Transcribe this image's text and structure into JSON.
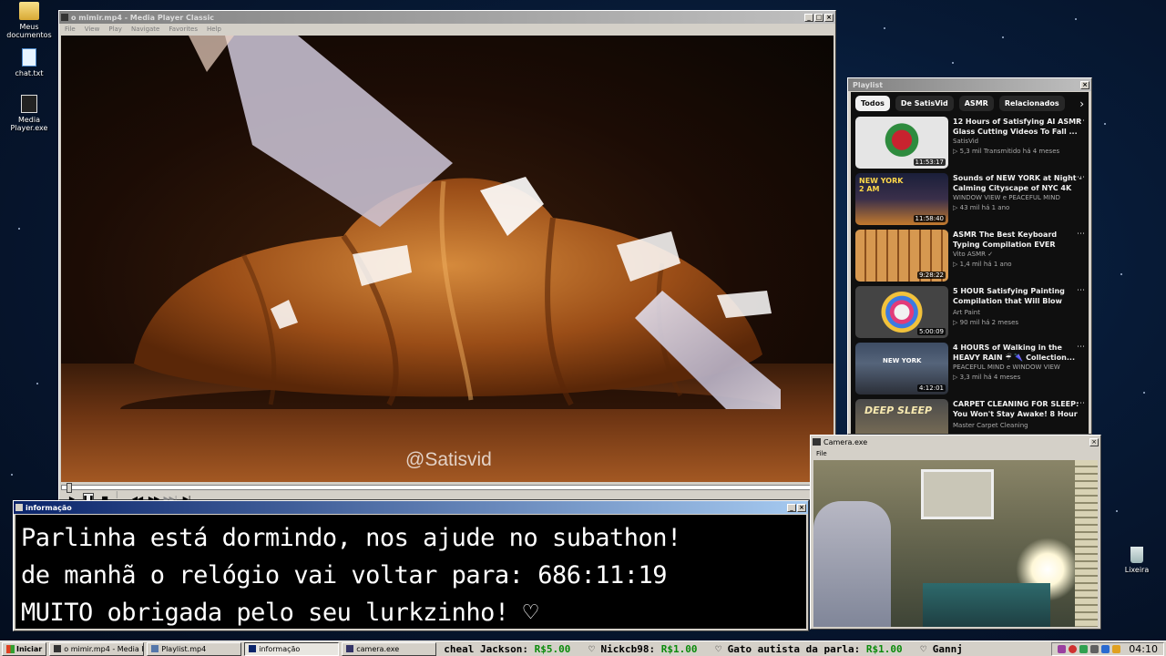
{
  "desktop": {
    "icons": [
      {
        "label": "Meus documentos",
        "icon": "folder-icon"
      },
      {
        "label": "chat.txt",
        "icon": "notepad-icon"
      },
      {
        "label": "Media Player.exe",
        "icon": "media-player-icon"
      },
      {
        "label": "Lixeira",
        "icon": "recycle-bin-icon"
      }
    ]
  },
  "media_player": {
    "title": "o mimir.mp4 - Media Player Classic",
    "menu": [
      "File",
      "View",
      "Play",
      "Navigate",
      "Favorites",
      "Help"
    ],
    "watermark": "@Satisvid",
    "progress": 0.0
  },
  "playlist": {
    "title": "Playlist",
    "chips": [
      "Todos",
      "De SatisVid",
      "ASMR",
      "Relacionados"
    ],
    "active_chip": "Todos",
    "videos": [
      {
        "title": "12 Hours of Satisfying AI ASMR Glass Cutting Videos To Fall ...",
        "channel": "SatisVid",
        "stats": "5,3 mil  Transmitido há 4 meses",
        "duration": "11:53:17",
        "thumb_text": ""
      },
      {
        "title": "Sounds of NEW YORK at Night - Calming Cityscape of NYC 4K",
        "channel": "WINDOW VIEW e PEACEFUL MIND",
        "stats": "43 mil  há 1 ano",
        "duration": "11:58:40",
        "thumb_text": "NEW YORK 2 AM"
      },
      {
        "title": "ASMR The Best Keyboard Typing Compilation EVER",
        "channel": "Vito ASMR ✓",
        "stats": "1,4 mil  há 1 ano",
        "duration": "9:28:22",
        "thumb_text": ""
      },
      {
        "title": "5 HOUR Satisfying Painting Compilation that Will Blow You...",
        "channel": "Art Paint",
        "stats": "90 mil  há 2 meses",
        "duration": "5:00:09",
        "thumb_text": ""
      },
      {
        "title": "4 HOURS of Walking in the HEAVY RAIN ☔ 🌂 Collection...",
        "channel": "PEACEFUL MIND e WINDOW VIEW",
        "stats": "3,3 mil  há 4 meses",
        "duration": "4:12:01",
        "thumb_text": "NEW YORK"
      },
      {
        "title": "CARPET CLEANING FOR SLEEP: You Won't Stay Awake! 8 Hour ...",
        "channel": "Master Carpet Cleaning",
        "stats": "",
        "duration": "",
        "thumb_text": "DEEP SLEEP"
      }
    ]
  },
  "info_window": {
    "title": "informação",
    "lines": [
      "Parlinha está dormindo, nos ajude no subathon!",
      "de manhã o relógio vai voltar para:  686:11:19",
      "MUITO obrigada pelo seu lurkzinho! ♡"
    ]
  },
  "camera_window": {
    "title": "Camera.exe",
    "menu": [
      "File"
    ]
  },
  "taskbar": {
    "start_label": "Iniciar",
    "tasks": [
      {
        "label": "o mimir.mp4 - Media Playe...",
        "pressed": false
      },
      {
        "label": "Playlist.mp4",
        "pressed": false
      },
      {
        "label": "informação",
        "pressed": true
      },
      {
        "label": "camera.exe",
        "pressed": false
      }
    ],
    "ticker": [
      {
        "name": "cheal Jackson:",
        "amount": "R$5.00"
      },
      {
        "name": "♡ Nickcb98:",
        "amount": "R$1.00"
      },
      {
        "name": "♡ Gato autista da parla:",
        "amount": "R$1.00"
      },
      {
        "name": "♡ Gannj",
        "amount": ""
      }
    ],
    "clock": "04:10"
  },
  "colors": {
    "title_active": "#0a246a",
    "ticker_amount": "#0a8a0a",
    "youtube_bg": "#0f0f0f"
  }
}
